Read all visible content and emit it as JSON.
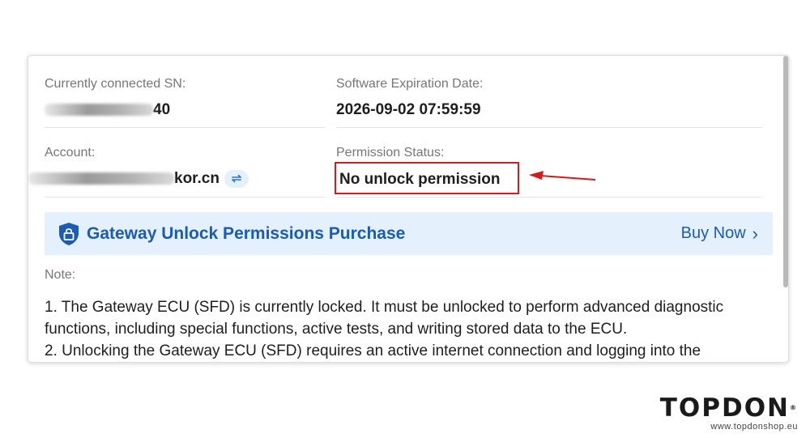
{
  "info": {
    "sn": {
      "label": "Currently connected SN:",
      "value_suffix": "40"
    },
    "expiration": {
      "label": "Software Expiration Date:",
      "value": "2026-09-02 07:59:59"
    },
    "account": {
      "label": "Account:",
      "value_suffix": "kor.cn",
      "switch_icon": "swap-arrows-icon"
    },
    "permission": {
      "label": "Permission Status:",
      "value": "No unlock permission"
    }
  },
  "banner": {
    "icon": "shield-lock-icon",
    "title": "Gateway Unlock Permissions Purchase",
    "action_label": "Buy Now",
    "action_icon": "chevron-right-icon"
  },
  "note": {
    "label": "Note:",
    "lines": [
      "1. The Gateway ECU (SFD) is currently locked. It must be unlocked to perform advanced diagnostic functions, including special functions, active tests, and writing stored data to the ECU.",
      "2. Unlocking the Gateway ECU (SFD) requires an active internet connection and logging into the"
    ]
  },
  "brand": {
    "name": "TOPDON",
    "mark": "®",
    "url": "www.topdonshop.eu"
  },
  "colors": {
    "accent": "#1a5bb3",
    "banner_bg": "#e4f0fb",
    "highlight_red": "#d21c1c"
  }
}
